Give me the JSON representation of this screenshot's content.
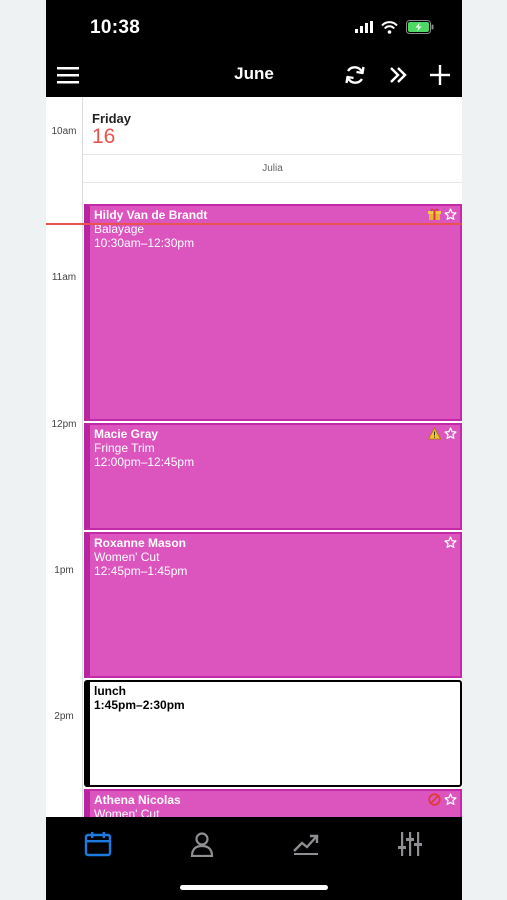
{
  "status_bar": {
    "time": "10:38"
  },
  "nav": {
    "title": "June"
  },
  "day": {
    "weekday": "Friday",
    "date": "16",
    "staff": "Julia"
  },
  "time_labels": [
    "10am",
    "11am",
    "12pm",
    "1pm",
    "2pm"
  ],
  "appointments": [
    {
      "client": "Hildy Van de Brandt",
      "service": "Balayage",
      "time": "10:30am–12:30pm"
    },
    {
      "client": "Macie Gray",
      "service": "Fringe Trim",
      "time": "12:00pm–12:45pm"
    },
    {
      "client": "Roxanne Mason",
      "service": "Women' Cut",
      "time": "12:45pm–1:45pm"
    },
    {
      "client": "Athena Nicolas",
      "service": "Women' Cut",
      "time": ""
    }
  ],
  "break": {
    "title": "lunch",
    "time": "1:45pm–2:30pm"
  },
  "colors": {
    "appointment": "#dc55bf",
    "now_line": "#e8534f",
    "active_tab": "#1f7ae0"
  },
  "tabs": [
    "calendar",
    "clients",
    "reports",
    "settings"
  ]
}
